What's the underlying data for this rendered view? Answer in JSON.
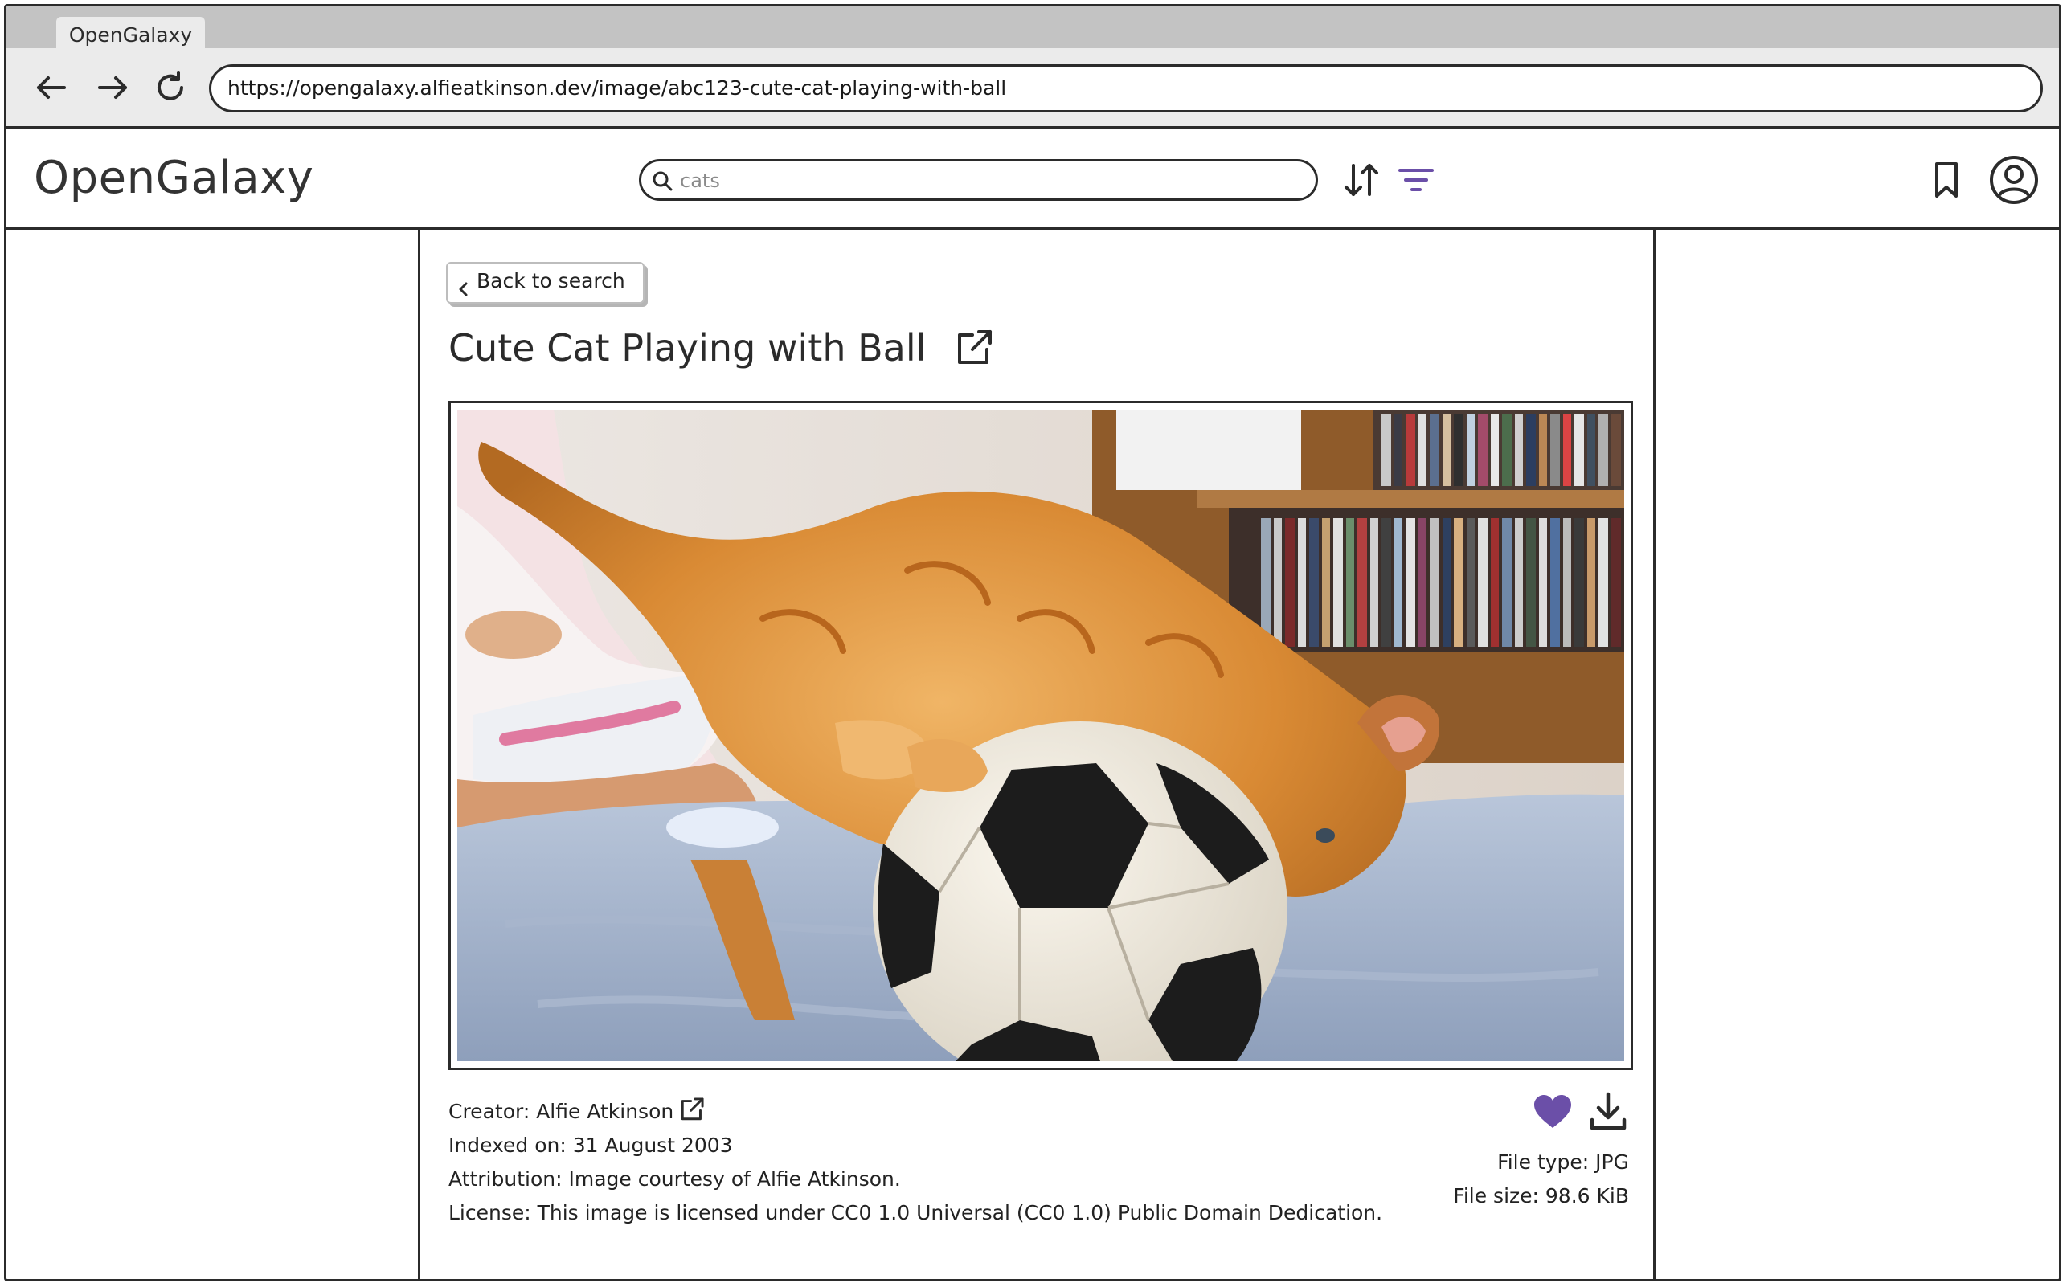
{
  "browser": {
    "tab_title": "OpenGalaxy",
    "url": "https://opengalaxy.alfieatkinson.dev/image/abc123-cute-cat-playing-with-ball"
  },
  "header": {
    "logo": "OpenGalaxy",
    "search_value": "cats",
    "accent_color": "#6b4fa8"
  },
  "page": {
    "back_label": "Back to search",
    "title": "Cute Cat Playing with Ball",
    "image_alt": "orange kitten playing on a black and white soccer ball"
  },
  "meta": {
    "creator": "Creator: Alfie Atkinson",
    "indexed_on": "Indexed on: 31 August 2003",
    "attribution": "Attribution: Image courtesy of Alfie Atkinson.",
    "license": "License: This image is licensed under CC0 1.0 Universal (CC0 1.0) Public Domain Dedication.",
    "file_type": "File type: JPG",
    "file_size": "File size: 98.6 KiB"
  },
  "icons": {
    "back": "arrow-left-icon",
    "forward": "arrow-right-icon",
    "reload": "reload-icon",
    "search": "search-icon",
    "sort": "sort-icon",
    "filter": "filter-icon",
    "bookmark": "bookmark-icon",
    "account": "user-circle-icon",
    "external_link": "external-link-icon",
    "like": "heart-icon",
    "download": "download-icon"
  }
}
